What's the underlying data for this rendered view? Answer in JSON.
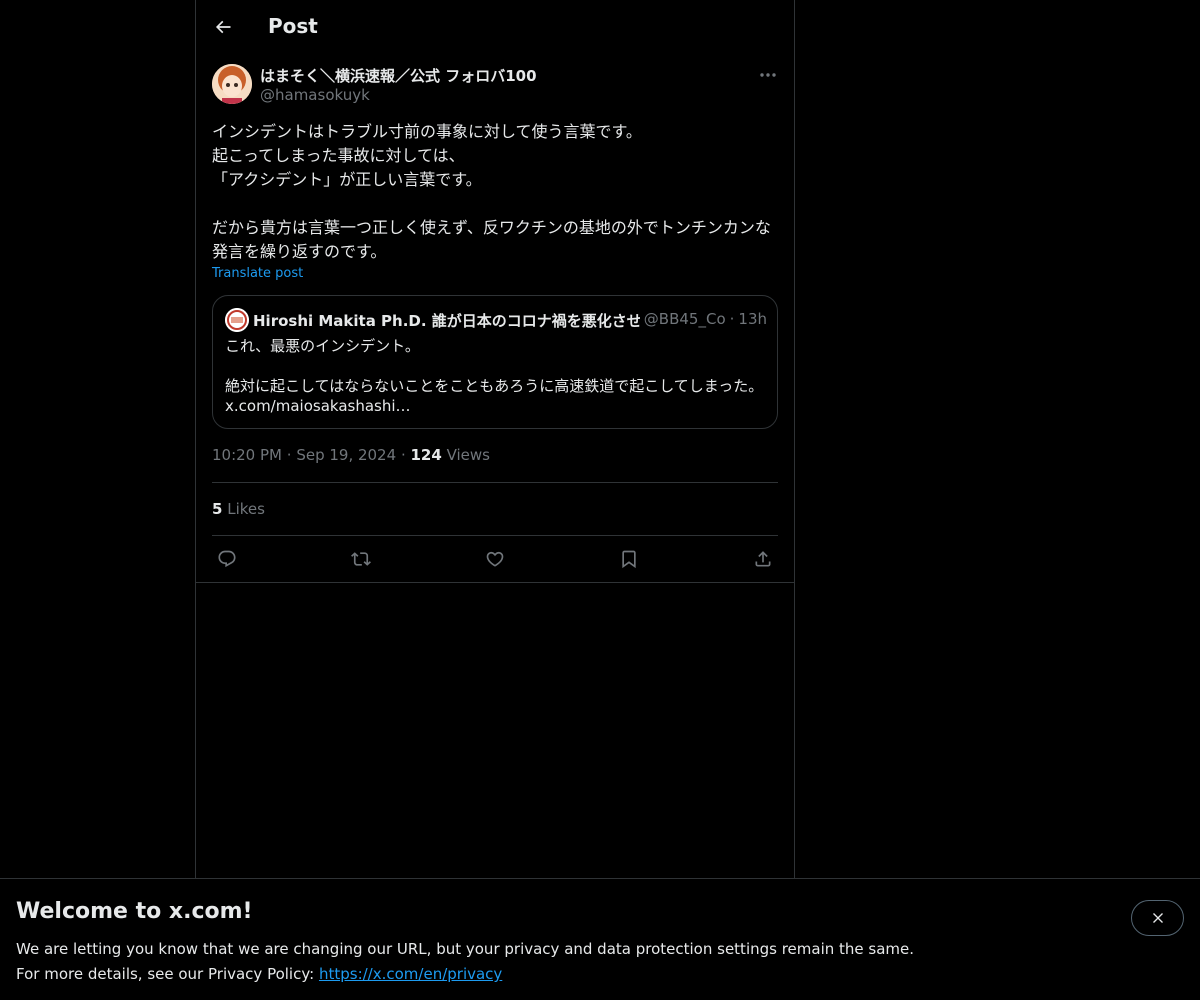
{
  "header": {
    "title": "Post"
  },
  "post": {
    "author_name": "はまそく＼横浜速報／公式 フォロバ100",
    "author_handle": "@hamasokuyk",
    "text_lines_1": "インシデントはトラブル寸前の事象に対して使う言葉です。\n起こってしまった事故に対しては、\n「アクシデント」が正しい言葉です。",
    "text_lines_2": "だから貴方は言葉一つ正しく使えず、反ワクチンの基地の外でトンチンカンな発言を繰り返すのです。",
    "translate_label": "Translate post",
    "time": "10:20 PM",
    "date": "Sep 19, 2024",
    "views_count": "124",
    "views_label": "Views",
    "likes_count": "5",
    "likes_label": "Likes"
  },
  "quote": {
    "author_name": "Hiroshi Makita Ph.D. 誰が日本のコロナ禍を悪化させたの",
    "author_handle": "@BB45_Co",
    "time": "13h",
    "text_1": "これ、最悪のインシデント。",
    "text_2": "絶対に起こしてはならないことをこともあろうに高速鉄道で起こしてしまった。",
    "link": "x.com/maiosakashashi…"
  },
  "actions": [
    "reply-icon",
    "repost-icon",
    "like-icon",
    "bookmark-icon",
    "share-icon"
  ],
  "banner": {
    "title": "Welcome to x.com!",
    "line1": "We are letting you know that we are changing our URL, but your privacy and data protection settings remain the same.",
    "line2_prefix": "For more details, see our Privacy Policy:",
    "link": "https://x.com/en/privacy"
  },
  "colors": {
    "background": "#000000",
    "text": "#e7e9ea",
    "muted": "#71767b",
    "accent": "#1d9bf0",
    "border": "#2f3336"
  }
}
